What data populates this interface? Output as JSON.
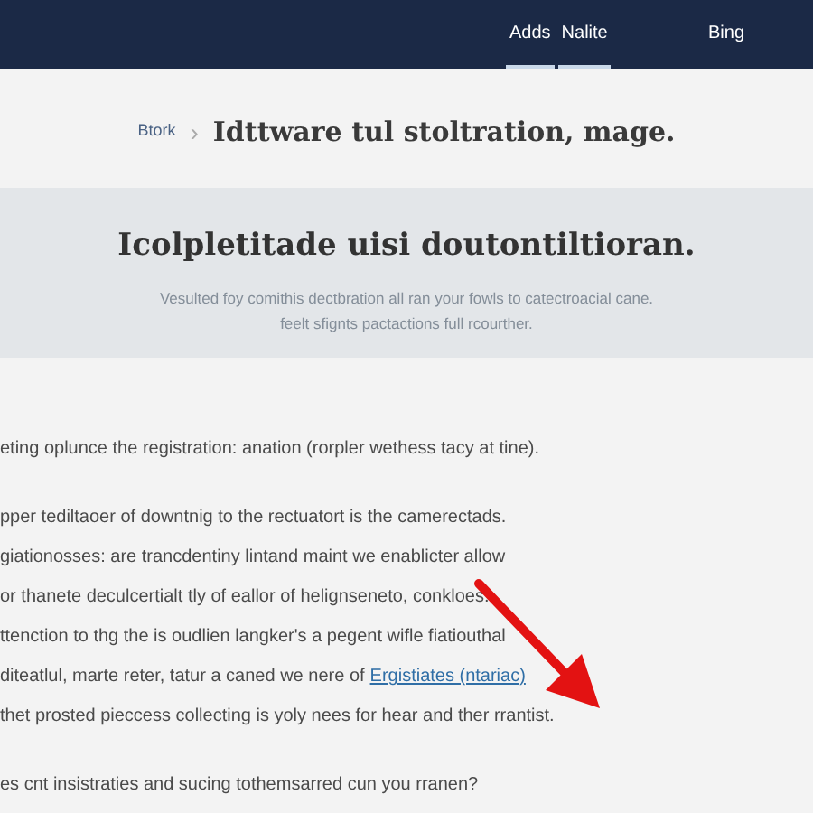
{
  "nav": [
    {
      "label": "Adds",
      "selected": true
    },
    {
      "label": "Nalite",
      "selected": true
    },
    {
      "label": "Bing",
      "selected": false
    }
  ],
  "breadcrumb": {
    "parent": "Btork",
    "separator": "›",
    "current": "Idttware tul stoltration, mage."
  },
  "hero": {
    "title": "Icolpletitade uisi doutontiltioran.",
    "subtitle_lines": [
      "Vesulted foy comithis dectbration all ran your fowls to catectroacial cane.",
      "feelt sfignts pactactions full rcourther."
    ]
  },
  "paragraphs": [
    {
      "lines": [
        {
          "text": "eting oplunce the registration: anation (rorpler wethess tacy at tine)."
        }
      ]
    },
    {
      "lines": [
        {
          "text": "pper tediltaoer of downtnig to the rectuatort is the camerectads."
        },
        {
          "text": "giationosses: are trancdentiny lintand maint we enablicter allow"
        },
        {
          "text": "or thanete deculcertialt tly of eallor of helignseneto, conkloes."
        },
        {
          "text": "ttenction to thg the is oudlien langker's a pegent wifle fiatiouthal"
        },
        {
          "text": "diteatlul, marte reter, tatur a caned we nere of",
          "link": "Ergistiates (ntariac)"
        },
        {
          "text": "thet prosted pieccess collecting is yoly nees for hear and ther rrantist."
        }
      ]
    },
    {
      "lines": [
        {
          "text": "es cnt insistraties and sucing tothemsarred cun you rranen?"
        }
      ]
    }
  ]
}
